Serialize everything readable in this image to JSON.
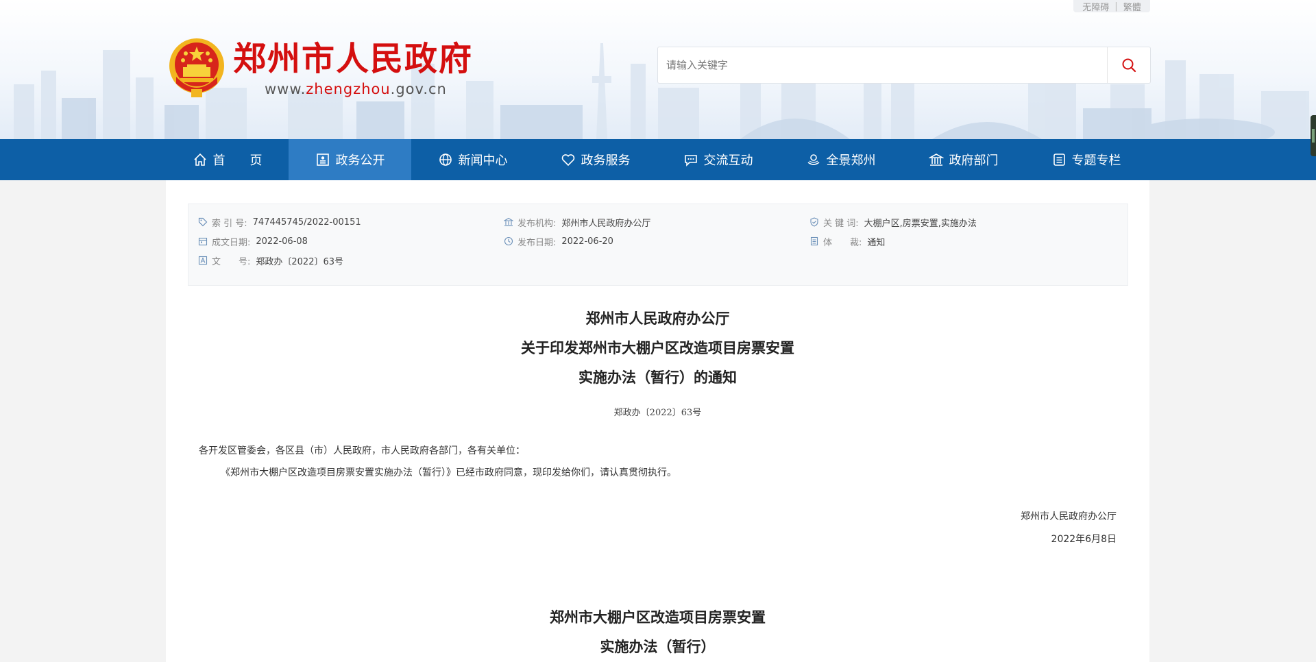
{
  "header": {
    "top_links": {
      "accessibility": "无障碍",
      "traditional": "繁體"
    },
    "site_name": "郑州市人民政府",
    "site_url": {
      "prefix": "www.",
      "accent": "zhengzhou",
      "suffix": ".gov.cn"
    },
    "search": {
      "placeholder": "请输入关键字"
    }
  },
  "nav": {
    "items": [
      {
        "label": "首　　页",
        "icon": "home-icon"
      },
      {
        "label": "政务公开",
        "icon": "document-icon",
        "active": true
      },
      {
        "label": "新闻中心",
        "icon": "globe-icon"
      },
      {
        "label": "政务服务",
        "icon": "heart-icon"
      },
      {
        "label": "交流互动",
        "icon": "chat-icon"
      },
      {
        "label": "全景郑州",
        "icon": "panorama-icon"
      },
      {
        "label": "政府部门",
        "icon": "building-icon"
      },
      {
        "label": "专题专栏",
        "icon": "list-icon"
      }
    ]
  },
  "meta": {
    "index_no": {
      "label": "索 引 号:",
      "value": "747445745/2022-00151"
    },
    "publisher": {
      "label": "发布机构:",
      "value": "郑州市人民政府办公厅"
    },
    "keywords": {
      "label": "关 键 词:",
      "value": "大棚户区,房票安置,实施办法"
    },
    "created": {
      "label": "成文日期:",
      "value": "2022-06-08"
    },
    "published": {
      "label": "发布日期:",
      "value": "2022-06-20"
    },
    "genre": {
      "label": "体　　裁:",
      "value": "通知"
    },
    "doc_no": {
      "label": "文　　号:",
      "value": "郑政办〔2022〕63号"
    }
  },
  "article": {
    "title_lines": [
      "郑州市人民政府办公厅",
      "关于印发郑州市大棚户区改造项目房票安置",
      "实施办法（暂行）的通知"
    ],
    "doc_number": "郑政办〔2022〕63号",
    "salutation": "各开发区管委会，各区县（市）人民政府，市人民政府各部门，各有关单位：",
    "paragraph": "《郑州市大棚户区改造项目房票安置实施办法（暂行）》已经市政府同意，现印发给你们，请认真贯彻执行。",
    "signature": "郑州市人民政府办公厅",
    "date": "2022年6月8日",
    "subtitle_lines": [
      "郑州市大棚户区改造项目房票安置",
      "实施办法（暂行）"
    ]
  },
  "colors": {
    "brand_red": "#d40f0f",
    "nav_blue": "#0d5fa6",
    "nav_active": "#2e7cc4"
  }
}
